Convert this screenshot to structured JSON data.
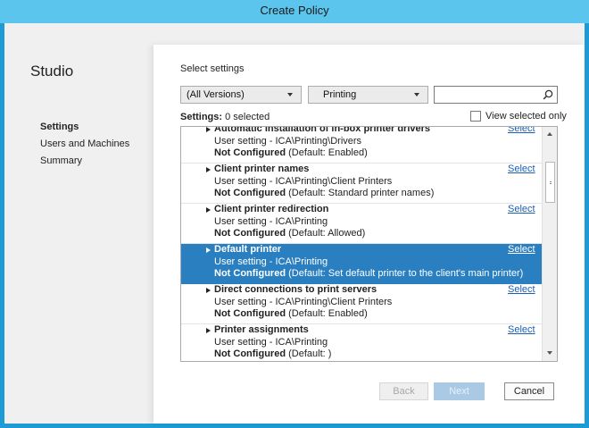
{
  "window": {
    "title": "Create Policy"
  },
  "brand": "Studio",
  "nav": {
    "items": [
      {
        "label": "Settings",
        "active": true
      },
      {
        "label": "Users and Machines",
        "active": false
      },
      {
        "label": "Summary",
        "active": false
      }
    ]
  },
  "main": {
    "section_title": "Select settings",
    "version_filter": "(All Versions)",
    "category_filter": "Printing",
    "search": {
      "value": "",
      "placeholder": ""
    },
    "settings_count_label": "Settings:",
    "settings_count_value": "0 selected",
    "view_selected_only": "View selected only",
    "select_link": "Select",
    "not_configured_label": "Not Configured",
    "rows": [
      {
        "name": "Automatic installation of in-box printer drivers",
        "path": "User setting - ICA\\Printing\\Drivers",
        "default": "(Default: Enabled)"
      },
      {
        "name": "Client printer names",
        "path": "User setting - ICA\\Printing\\Client Printers",
        "default": "(Default: Standard printer names)"
      },
      {
        "name": "Client printer redirection",
        "path": "User setting - ICA\\Printing",
        "default": "(Default: Allowed)"
      },
      {
        "name": "Default printer",
        "path": "User setting - ICA\\Printing",
        "default": "(Default: Set default printer to the client's main printer)"
      },
      {
        "name": "Direct connections to print servers",
        "path": "User setting - ICA\\Printing\\Client Printers",
        "default": "(Default: Enabled)"
      },
      {
        "name": "Printer assignments",
        "path": "User setting - ICA\\Printing",
        "default": "(Default: )"
      }
    ]
  },
  "buttons": {
    "back": "Back",
    "next": "Next",
    "cancel": "Cancel"
  },
  "colors": {
    "accent": "#2a7fc0",
    "title_bar": "#5bc5ee",
    "frame": "#1e9bd7",
    "link": "#1a5fb4"
  },
  "icons": {
    "search": "search-icon"
  }
}
